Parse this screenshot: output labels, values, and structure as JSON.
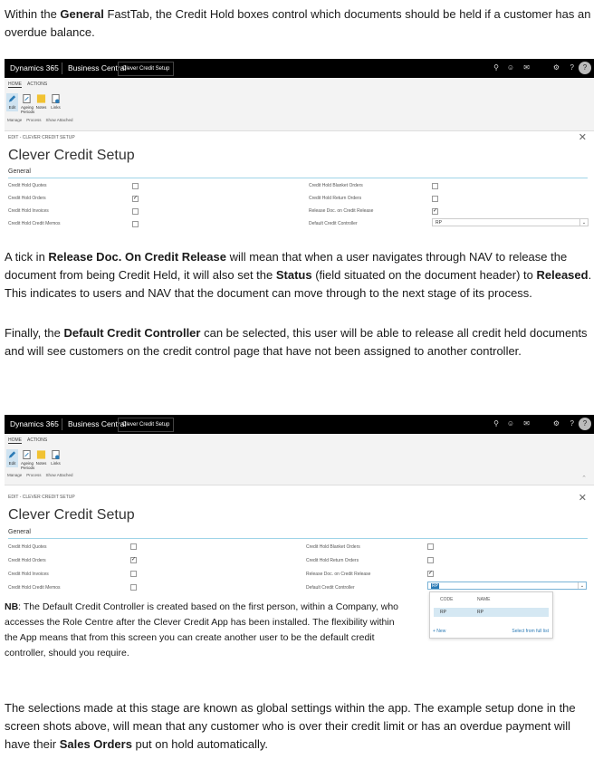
{
  "intro": {
    "p1": "Within the ",
    "p1_bold": "General",
    "p1_rest": " FastTab, the Credit Hold boxes control which documents should be held if a customer has an overdue balance."
  },
  "app": {
    "brand": "Dynamics 365",
    "app_name": "Business Central",
    "page_tag": "Clever Credit Setup",
    "avatar": "?"
  },
  "ribbon": {
    "tabs": [
      "HOME",
      "ACTIONS"
    ],
    "buttons": [
      "Edit",
      "Ageing Periods",
      "Notes",
      "Links"
    ],
    "groups": [
      "Manage",
      "Process",
      "Show Attached"
    ]
  },
  "page": {
    "breadcrumb": "EDIT - CLEVER CREDIT SETUP",
    "title": "Clever Credit Setup",
    "section": "General"
  },
  "fields_left": [
    {
      "label": "Credit Hold Quotes",
      "checked": false
    },
    {
      "label": "Credit Hold Orders",
      "checked": true
    },
    {
      "label": "Credit Hold Invoices",
      "checked": false
    },
    {
      "label": "Credit Hold Credit Memos",
      "checked": false
    }
  ],
  "fields_right": [
    {
      "label": "Credit Hold Blanket Orders",
      "checked": false
    },
    {
      "label": "Credit Hold Return Orders",
      "checked": false
    },
    {
      "label": "Release Doc. on Credit Release",
      "checked": true
    }
  ],
  "controller": {
    "label": "Default Credit Controller",
    "value": "RP"
  },
  "para2": {
    "a": "A tick in ",
    "b1": "Release Doc. On Credit Release",
    "c": " will mean that when a user navigates through NAV to release the document from being Credit Held, it will also set the ",
    "b2": "Status",
    "d": " (field situated on the document header) to ",
    "b3": "Released",
    "e": ". This indicates to users and NAV that the document can move through to the next stage of its process."
  },
  "para3": {
    "a": "Finally, the ",
    "b1": "Default Credit Controller",
    "c": " can be selected, this user will be able to release all credit held documents and will see customers on the credit control page that have not been assigned to another controller."
  },
  "nb": {
    "label": "NB",
    "text": ": The Default Credit Controller is created based on the first person, within a Company, who accesses the Role Centre after the Clever Credit App has been installed. The flexibility within the App means that from this screen you can create another user to be the default credit controller, should you require."
  },
  "lookup": {
    "col_code": "CODE",
    "col_name": "NAME",
    "row_code": "RP",
    "row_name": "RP",
    "new_label": "+ New",
    "select_label": "Select from full list"
  },
  "para4": {
    "a": "The selections made at this stage are known as global settings within the app. The example setup done in the screen shots above, will mean that any customer who is over their credit limit or has an overdue payment will have their ",
    "b1": "Sales Orders",
    "c": " put on hold automatically."
  }
}
